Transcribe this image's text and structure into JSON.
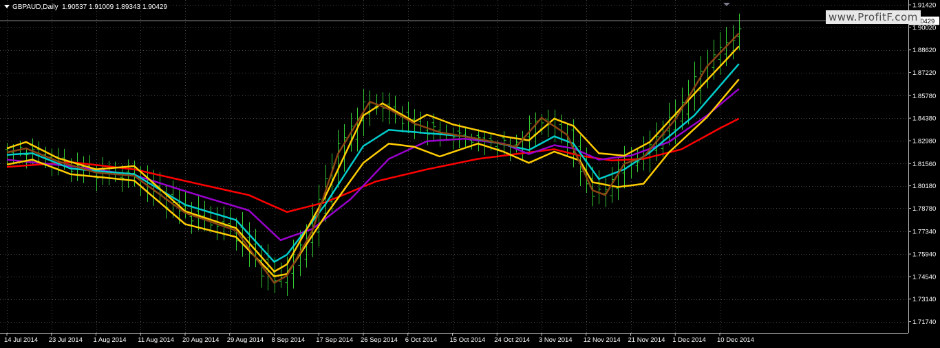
{
  "chart_data": {
    "type": "line",
    "title": "GBPAUD,Daily",
    "ohlc": {
      "open": "1.90537",
      "high": "1.91009",
      "low": "1.89343",
      "close": "1.90429"
    },
    "current_price": "1.90429",
    "watermark": "www.ProfitF.com",
    "ylim": [
      1.7104,
      1.9172
    ],
    "yticks": [
      "1.91420",
      "1.90020",
      "1.88620",
      "1.87220",
      "1.85780",
      "1.84380",
      "1.82980",
      "1.81560",
      "1.80180",
      "1.78780",
      "1.77340",
      "1.75940",
      "1.74540",
      "1.73140",
      "1.71740"
    ],
    "xticks": [
      "14 Jul 2014",
      "23 Jul 2014",
      "1 Aug 2014",
      "11 Aug 2014",
      "20 Aug 2014",
      "29 Aug 2014",
      "8 Sep 2014",
      "17 Sep 2014",
      "26 Sep 2014",
      "6 Oct 2014",
      "15 Oct 2014",
      "24 Oct 2014",
      "3 Nov 2014",
      "12 Nov 2014",
      "21 Nov 2014",
      "1 Dec 2014",
      "10 Dec 2014"
    ],
    "xtick_index": [
      0,
      7,
      14,
      21,
      28,
      35,
      42,
      49,
      56,
      63,
      70,
      77,
      84,
      91,
      98,
      105,
      112
    ],
    "bars": 116,
    "grid": true,
    "colors": {
      "background": "#000000",
      "grid": "#4a4a4a",
      "axis": "#c0c0c0",
      "candles": "#32cd32"
    },
    "series": [
      {
        "color": "#ff0000",
        "key": [
          [
            0,
            1.8135
          ],
          [
            10,
            1.8165
          ],
          [
            20,
            1.812
          ],
          [
            30,
            1.803
          ],
          [
            38,
            1.796
          ],
          [
            44,
            1.7855
          ],
          [
            50,
            1.7915
          ],
          [
            58,
            1.8045
          ],
          [
            66,
            1.812
          ],
          [
            74,
            1.8185
          ],
          [
            82,
            1.8225
          ],
          [
            86,
            1.8245
          ],
          [
            90,
            1.8205
          ],
          [
            95,
            1.8175
          ],
          [
            100,
            1.8185
          ],
          [
            106,
            1.8245
          ],
          [
            112,
            1.8375
          ],
          [
            115,
            1.8435
          ]
        ]
      },
      {
        "color": "#9900cc",
        "key": [
          [
            0,
            1.818
          ],
          [
            10,
            1.814
          ],
          [
            20,
            1.8085
          ],
          [
            30,
            1.796
          ],
          [
            38,
            1.7865
          ],
          [
            43,
            1.768
          ],
          [
            48,
            1.775
          ],
          [
            54,
            1.7935
          ],
          [
            60,
            1.8185
          ],
          [
            66,
            1.8295
          ],
          [
            72,
            1.831
          ],
          [
            78,
            1.828
          ],
          [
            82,
            1.8215
          ],
          [
            86,
            1.827
          ],
          [
            89,
            1.825
          ],
          [
            93,
            1.818
          ],
          [
            98,
            1.8205
          ],
          [
            104,
            1.829
          ],
          [
            110,
            1.8455
          ],
          [
            115,
            1.862
          ]
        ]
      },
      {
        "color": "#00cccc",
        "key": [
          [
            0,
            1.821
          ],
          [
            4,
            1.822
          ],
          [
            10,
            1.8125
          ],
          [
            20,
            1.809
          ],
          [
            28,
            1.79
          ],
          [
            36,
            1.7805
          ],
          [
            42,
            1.7545
          ],
          [
            44,
            1.759
          ],
          [
            50,
            1.79
          ],
          [
            56,
            1.8265
          ],
          [
            60,
            1.8365
          ],
          [
            66,
            1.8345
          ],
          [
            72,
            1.8325
          ],
          [
            78,
            1.8275
          ],
          [
            82,
            1.824
          ],
          [
            86,
            1.8325
          ],
          [
            89,
            1.828
          ],
          [
            93,
            1.806
          ],
          [
            97,
            1.812
          ],
          [
            101,
            1.8225
          ],
          [
            108,
            1.8455
          ],
          [
            115,
            1.8775
          ]
        ]
      },
      {
        "color": "#ffcc00",
        "key": [
          [
            0,
            1.825
          ],
          [
            3,
            1.829
          ],
          [
            8,
            1.819
          ],
          [
            14,
            1.812
          ],
          [
            20,
            1.814
          ],
          [
            28,
            1.786
          ],
          [
            36,
            1.7755
          ],
          [
            42,
            1.7485
          ],
          [
            44,
            1.753
          ],
          [
            50,
            1.795
          ],
          [
            56,
            1.8455
          ],
          [
            59,
            1.853
          ],
          [
            64,
            1.8415
          ],
          [
            66,
            1.846
          ],
          [
            70,
            1.84
          ],
          [
            78,
            1.8325
          ],
          [
            82,
            1.83
          ],
          [
            86,
            1.8435
          ],
          [
            89,
            1.839
          ],
          [
            93,
            1.822
          ],
          [
            97,
            1.8205
          ],
          [
            101,
            1.829
          ],
          [
            108,
            1.859
          ],
          [
            115,
            1.8885
          ]
        ]
      },
      {
        "color": "#ffcc00",
        "key": [
          [
            0,
            1.815
          ],
          [
            4,
            1.818
          ],
          [
            10,
            1.809
          ],
          [
            20,
            1.805
          ],
          [
            28,
            1.778
          ],
          [
            36,
            1.77
          ],
          [
            42,
            1.7455
          ],
          [
            44,
            1.747
          ],
          [
            50,
            1.783
          ],
          [
            56,
            1.816
          ],
          [
            60,
            1.828
          ],
          [
            64,
            1.826
          ],
          [
            68,
            1.82
          ],
          [
            74,
            1.828
          ],
          [
            78,
            1.823
          ],
          [
            82,
            1.816
          ],
          [
            86,
            1.823
          ],
          [
            90,
            1.8175
          ],
          [
            92,
            1.804
          ],
          [
            96,
            1.801
          ],
          [
            100,
            1.803
          ],
          [
            104,
            1.8225
          ],
          [
            110,
            1.8445
          ],
          [
            115,
            1.868
          ]
        ]
      },
      {
        "color": "#8b4513",
        "key": [
          [
            0,
            1.8225
          ],
          [
            3,
            1.825
          ],
          [
            8,
            1.817
          ],
          [
            14,
            1.81
          ],
          [
            20,
            1.808
          ],
          [
            28,
            1.785
          ],
          [
            36,
            1.774
          ],
          [
            42,
            1.7415
          ],
          [
            44,
            1.746
          ],
          [
            48,
            1.774
          ],
          [
            52,
            1.8215
          ],
          [
            57,
            1.854
          ],
          [
            60,
            1.8495
          ],
          [
            64,
            1.8405
          ],
          [
            68,
            1.835
          ],
          [
            74,
            1.831
          ],
          [
            80,
            1.826
          ],
          [
            84,
            1.844
          ],
          [
            88,
            1.8335
          ],
          [
            92,
            1.799
          ],
          [
            94,
            1.796
          ],
          [
            97,
            1.8155
          ],
          [
            100,
            1.8195
          ],
          [
            105,
            1.843
          ],
          [
            110,
            1.876
          ],
          [
            115,
            1.8965
          ]
        ]
      }
    ]
  }
}
